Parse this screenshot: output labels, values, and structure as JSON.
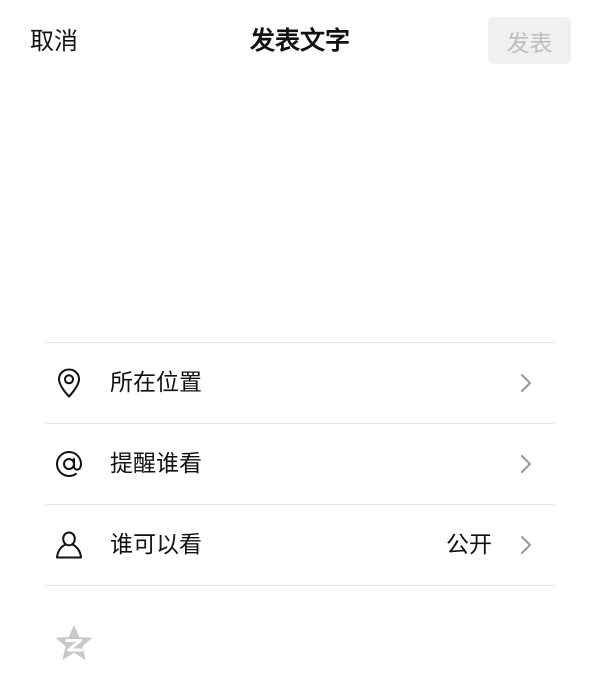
{
  "header": {
    "cancel_label": "取消",
    "title": "发表文字",
    "publish_label": "发表"
  },
  "editor": {
    "value": "",
    "placeholder": ""
  },
  "options": [
    {
      "icon": "location-pin-icon",
      "label": "所在位置",
      "value": ""
    },
    {
      "icon": "at-sign-icon",
      "label": "提醒谁看",
      "value": ""
    },
    {
      "icon": "person-icon",
      "label": "谁可以看",
      "value": "公开"
    }
  ],
  "footer": {
    "icon": "qzone-star-icon"
  },
  "colors": {
    "text": "#111111",
    "divider": "#e6e6e6",
    "publish_bg": "#f0f0f0",
    "publish_text": "#bdbdbd",
    "chevron": "#999999",
    "qzone_icon": "#c8c8c8"
  }
}
